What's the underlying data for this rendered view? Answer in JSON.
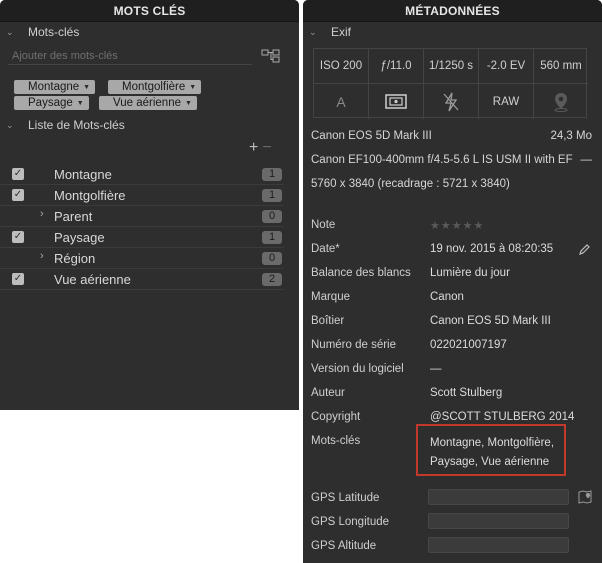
{
  "left": {
    "title": "MOTS CLÉS",
    "keywords_section": "Mots-clés",
    "input_placeholder": "Ajouter des mots-clés",
    "tags": [
      "Montagne",
      "Montgolfière",
      "Paysage",
      "Vue aérienne"
    ],
    "list_section": "Liste de Mots-clés",
    "add_symbol": "+",
    "remove_symbol": "−",
    "rows": [
      {
        "label": "Montagne",
        "count": "1",
        "checked": true,
        "expandable": false
      },
      {
        "label": "Montgolfière",
        "count": "1",
        "checked": true,
        "expandable": false
      },
      {
        "label": "Parent",
        "count": "0",
        "checked": false,
        "expandable": true
      },
      {
        "label": "Paysage",
        "count": "1",
        "checked": true,
        "expandable": false
      },
      {
        "label": "Région",
        "count": "0",
        "checked": false,
        "expandable": true
      },
      {
        "label": "Vue aérienne",
        "count": "2",
        "checked": true,
        "expandable": false
      }
    ]
  },
  "right": {
    "title": "MÉTADONNÉES",
    "exif_section": "Exif",
    "exif_top": [
      "ISO 200",
      "ƒ/11.0",
      "1/1250 s",
      "-2.0 EV",
      "560 mm"
    ],
    "exif_bottom_icons": [
      "auto-mode-icon",
      "metering-icon",
      "flash-off-icon",
      "raw-format",
      "location-icon"
    ],
    "exif_auto": "A",
    "exif_raw": "RAW",
    "camera": "Canon EOS 5D Mark III",
    "file_size": "24,3 Mo",
    "lens": "Canon EF100-400mm f/4.5-5.6 L IS USM II with EF…",
    "lens_dash": "—",
    "dimensions": "5760 x 3840 (recadrage : 5721 x 3840)",
    "fields": [
      {
        "label": "Note",
        "value": "★★★★★"
      },
      {
        "label": "Date",
        "asterisk": "*",
        "value": "19 nov. 2015 à 08:20:35"
      },
      {
        "label": "Balance des blancs",
        "value": "Lumière du jour"
      },
      {
        "label": "Marque",
        "value": "Canon"
      },
      {
        "label": "Boîtier",
        "value": "Canon EOS 5D Mark III"
      },
      {
        "label": "Numéro de série",
        "value": "022021007197"
      },
      {
        "label": "Version du logiciel",
        "value": "—"
      },
      {
        "label": "Auteur",
        "value": "Scott Stulberg"
      },
      {
        "label": "Copyright",
        "value": "@SCOTT STULBERG 2014"
      }
    ],
    "keywords_label": "Mots-clés",
    "keywords_line1": "Montagne, Montgolfière,",
    "keywords_line2": "Paysage, Vue aérienne",
    "gps": [
      {
        "label": "GPS Latitude",
        "value": ""
      },
      {
        "label": "GPS Longitude",
        "value": ""
      },
      {
        "label": "GPS Altitude",
        "value": ""
      }
    ],
    "highlight_color": "#c0392b"
  }
}
